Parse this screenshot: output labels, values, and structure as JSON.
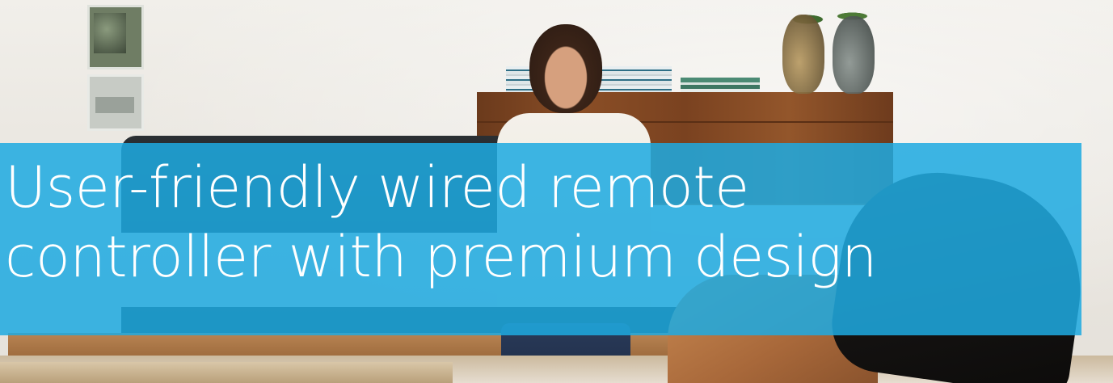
{
  "banner": {
    "headline_line_1": "User-friendly wired remote",
    "headline_line_2": "controller with premium design",
    "overlay_color": "#1eaae1",
    "text_color": "#ffffff"
  },
  "photo": {
    "subject": "woman-reading-on-sofa"
  }
}
